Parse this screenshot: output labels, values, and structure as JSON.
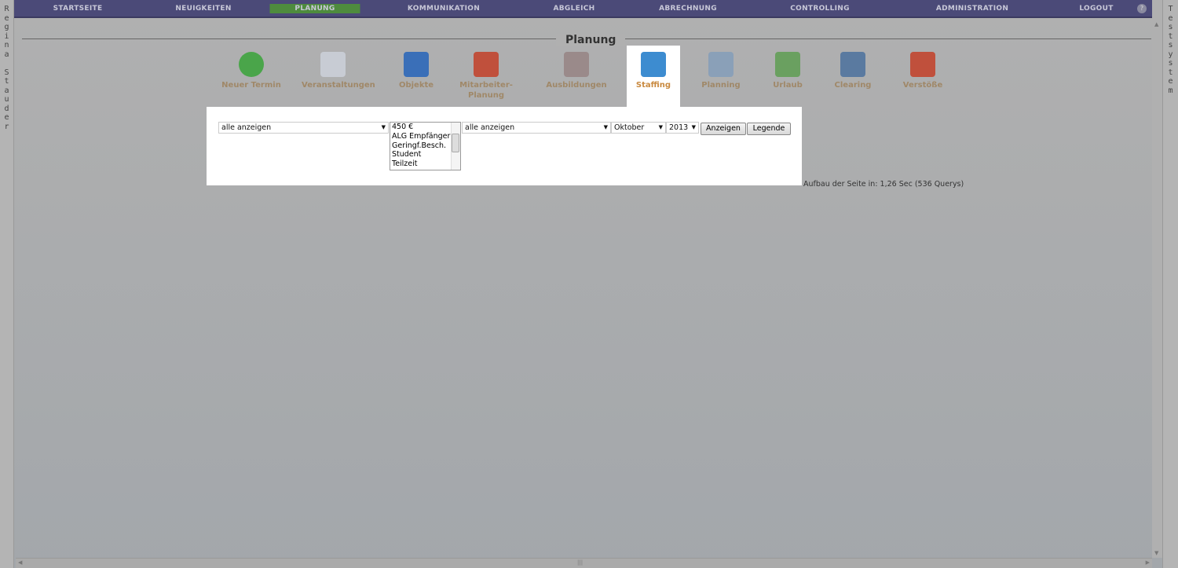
{
  "user_name": "Regina Stauder",
  "system_label": "Testsystem",
  "nav": [
    "STARTSEITE",
    "NEUIGKEITEN",
    "PLANUNG",
    "KOMMUNIKATION",
    "ABGLEICH",
    "ABRECHNUNG",
    "CONTROLLING",
    "ADMINISTRATION",
    "LOGOUT"
  ],
  "nav_active": "PLANUNG",
  "page_title": "Planung",
  "tools": [
    {
      "label": "Neuer Termin",
      "icon": "plus-circle-icon",
      "color": "#4aa54a"
    },
    {
      "label": "Veranstaltungen",
      "icon": "flowchart-icon",
      "color": "#c8ccd4"
    },
    {
      "label": "Objekte",
      "icon": "cube-icon",
      "color": "#3a6fb8"
    },
    {
      "label": "Mitarbeiter-Planung",
      "icon": "people-icon",
      "color": "#c0503c"
    },
    {
      "label": "Ausbildungen",
      "icon": "book-icon",
      "color": "#9a8a8a"
    },
    {
      "label": "Staffing",
      "icon": "staffing-sheet-icon",
      "color": "#3d8cd0"
    },
    {
      "label": "Planning",
      "icon": "calendar-grid-icon",
      "color": "#8aa0b8"
    },
    {
      "label": "Urlaub",
      "icon": "gantt-icon",
      "color": "#6aa060"
    },
    {
      "label": "Clearing",
      "icon": "lamp-icon",
      "color": "#5a7aa0"
    },
    {
      "label": "Verstöße",
      "icon": "violation-icon",
      "color": "#c0503c"
    }
  ],
  "active_tool": "Staffing",
  "filters": {
    "select1": "alle anzeigen",
    "employment_types": [
      "450 €",
      "ALG Empfänger",
      "Geringf.Besch.",
      "Student",
      "Teilzeit"
    ],
    "select2": "alle anzeigen",
    "month": "Oktober",
    "year": "2013",
    "show_button": "Anzeigen",
    "legend_button": "Legende"
  },
  "perf_text": "Aufbau der Seite in: 1,26 Sec (536 Querys)"
}
